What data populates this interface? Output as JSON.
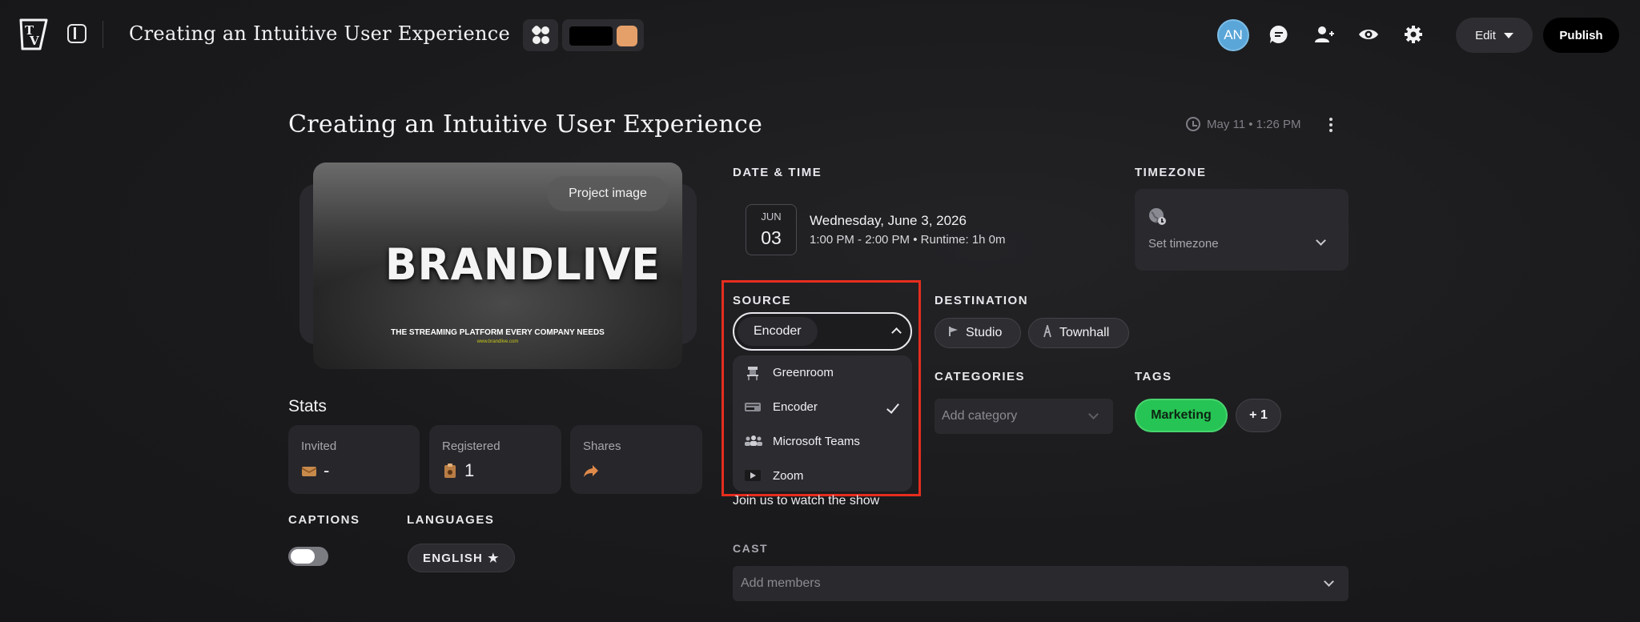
{
  "header": {
    "title": "Creating an Intuitive User Experience",
    "avatar_initials": "AN",
    "edit_label": "Edit",
    "publish_label": "Publish",
    "icons": [
      "logo-tv",
      "sidebar-toggle-icon",
      "theme-icon",
      "comment-icon",
      "add-user-icon",
      "preview-eye-icon",
      "settings-gear-icon"
    ],
    "swatches": [
      "#000000",
      "#e59f69"
    ]
  },
  "page": {
    "title": "Creating an Intuitive User Experience",
    "timestamp": "May 11 • 1:26 PM"
  },
  "project_image": {
    "button_label": "Project image",
    "brand_text": "BRANDLIVE",
    "tagline": "THE STREAMING PLATFORM EVERY COMPANY NEEDS",
    "url": "www.brandlive.com"
  },
  "stats": {
    "title": "Stats",
    "cards": [
      {
        "label": "Invited",
        "value": "-"
      },
      {
        "label": "Registered",
        "value": "1"
      },
      {
        "label": "Shares",
        "value": ""
      }
    ]
  },
  "captions": {
    "label": "CAPTIONS",
    "enabled": false
  },
  "languages": {
    "label": "LANGUAGES",
    "items": [
      "ENGLISH"
    ]
  },
  "datetime": {
    "label": "DATE & TIME",
    "month": "JUN",
    "day": "03",
    "date_text": "Wednesday, June 3, 2026",
    "time_text": "1:00 PM - 2:00 PM • Runtime: 1h 0m"
  },
  "timezone": {
    "label": "TIMEZONE",
    "placeholder": "Set timezone"
  },
  "source": {
    "label": "SOURCE",
    "selected": "Encoder",
    "options": [
      {
        "label": "Greenroom",
        "icon": "greenroom-icon",
        "selected": false
      },
      {
        "label": "Encoder",
        "icon": "encoder-icon",
        "selected": true
      },
      {
        "label": "Microsoft Teams",
        "icon": "teams-icon",
        "selected": false
      },
      {
        "label": "Zoom",
        "icon": "zoom-icon",
        "selected": false
      }
    ]
  },
  "destination": {
    "label": "DESTINATION",
    "items": [
      "Studio",
      "Townhall"
    ]
  },
  "categories": {
    "label": "CATEGORIES",
    "placeholder": "Add category"
  },
  "tags": {
    "label": "TAGS",
    "items": [
      "Marketing"
    ],
    "more": "+ 1",
    "active_color": "#26c454"
  },
  "description": "Join us to watch the show",
  "cast": {
    "label": "CAST",
    "placeholder": "Add members"
  },
  "colors": {
    "background": "#1a1a1c",
    "highlight": "#e62d1e",
    "accent_orange": "#e59f69",
    "avatar": "#5aa6d8"
  }
}
